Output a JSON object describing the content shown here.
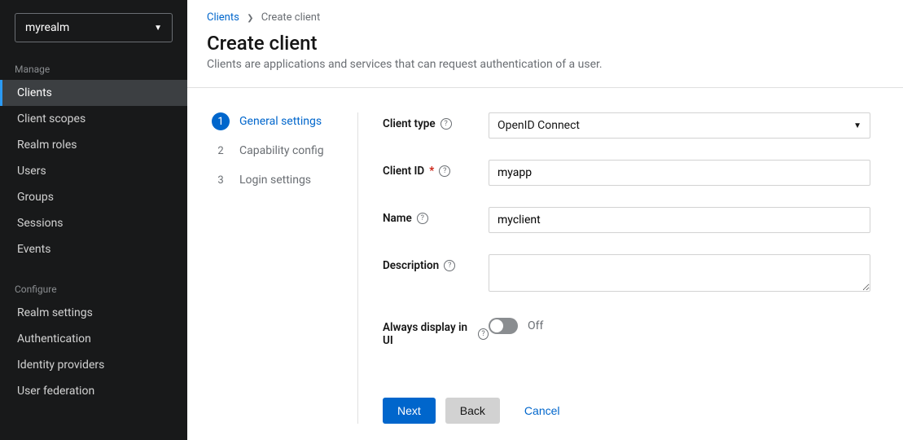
{
  "sidebar": {
    "realm": "myrealm",
    "sections": {
      "manage": {
        "title": "Manage",
        "items": [
          "Clients",
          "Client scopes",
          "Realm roles",
          "Users",
          "Groups",
          "Sessions",
          "Events"
        ]
      },
      "configure": {
        "title": "Configure",
        "items": [
          "Realm settings",
          "Authentication",
          "Identity providers",
          "User federation"
        ]
      }
    },
    "active": "Clients"
  },
  "breadcrumb": {
    "parent": "Clients",
    "current": "Create client"
  },
  "header": {
    "title": "Create client",
    "desc": "Clients are applications and services that can request authentication of a user."
  },
  "wizard": {
    "steps": [
      {
        "num": "1",
        "label": "General settings",
        "active": true
      },
      {
        "num": "2",
        "label": "Capability config",
        "active": false
      },
      {
        "num": "3",
        "label": "Login settings",
        "active": false
      }
    ]
  },
  "form": {
    "clientType": {
      "label": "Client type",
      "value": "OpenID Connect"
    },
    "clientId": {
      "label": "Client ID",
      "required": true,
      "value": "myapp"
    },
    "name": {
      "label": "Name",
      "value": "myclient"
    },
    "description": {
      "label": "Description",
      "value": ""
    },
    "alwaysDisplay": {
      "label": "Always display in UI",
      "value": false,
      "text": "Off"
    }
  },
  "footer": {
    "next": "Next",
    "back": "Back",
    "cancel": "Cancel"
  }
}
